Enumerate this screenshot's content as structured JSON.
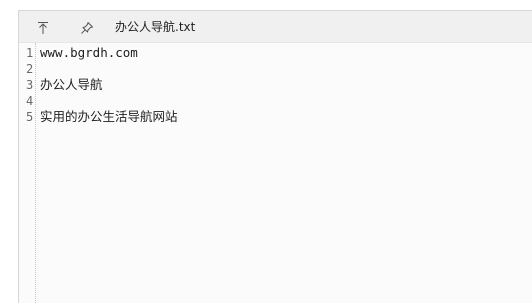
{
  "window": {
    "title": "办公人导航.txt",
    "toolbar": {
      "keep_on_top_icon": "arrow-to-top-icon",
      "pin_icon": "pushpin-icon"
    }
  },
  "editor": {
    "lines": [
      {
        "number": "1",
        "text": "www.bgrdh.com"
      },
      {
        "number": "2",
        "text": ""
      },
      {
        "number": "3",
        "text": "办公人导航"
      },
      {
        "number": "4",
        "text": ""
      },
      {
        "number": "5",
        "text": "实用的办公生活导航网站"
      }
    ]
  }
}
